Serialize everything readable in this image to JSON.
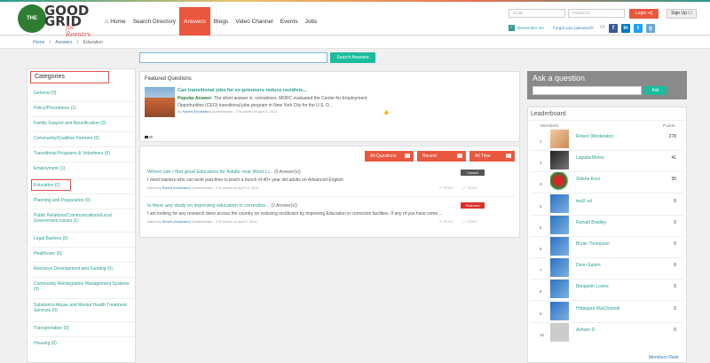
{
  "header": {
    "logo_badge": "THE",
    "logo_name_line1": "GOOD",
    "logo_name_line2": "GRID",
    "logo_sub": "for Reentry",
    "nav": [
      "Home",
      "Search Directory",
      "Answers",
      "Blogs",
      "Video Channel",
      "Events",
      "Jobs"
    ],
    "active_nav": "Answers",
    "email_placeholder": "Email",
    "password_placeholder": "Password",
    "login_label": "Login ➔]",
    "signup_label": "Sign Up ☐",
    "remember_label": "Remember me",
    "forgot_label": "Forgot your password?",
    "or_label": "Or",
    "social": [
      {
        "icon": "facebook-icon",
        "glyph": "f",
        "color": "#3b5998"
      },
      {
        "icon": "linkedin-icon",
        "glyph": "in",
        "color": "#0077b5"
      },
      {
        "icon": "twitter-icon",
        "glyph": "t",
        "color": "#1da1f2"
      },
      {
        "icon": "google-icon",
        "glyph": "g",
        "color": "#6aa7d8"
      }
    ]
  },
  "breadcrumb": [
    "Home",
    "/",
    "Answers",
    "/",
    "Education"
  ],
  "search": {
    "button": "Search Answers"
  },
  "categories": {
    "title": "Categories",
    "active": "Education (2)",
    "items": [
      "General (0)",
      "Policy/Procedures (1)",
      "Family Support and Reunification (0)",
      "Community/Coalition Partners (0)",
      "Transitional Programs & Volunteers (0)",
      "Employment (1)",
      "Education (2)",
      "Planning and Preparation (0)",
      "Public Relations/Communications/Local Government Issues (1)",
      "Legal Barriers (0)",
      "Healthcare (0)",
      "Resource Development and Funding (0)",
      "Community Reintegration Management Systems (0)",
      "Substance Abuse and Mental Health Treatment Services (0)",
      "Transportation (0)",
      "Housing (0)"
    ]
  },
  "featured": {
    "title": "Featured Questions",
    "question": "Can transitional jobs for ex-prisoners reduce recidivis...",
    "answer_label": "Popular Answer:",
    "answer_text": "The short answer is: sometimes. MDRC evaluated the Center for Employment Opportunities (CEO) transitional jobs program in New York City for the U.S. D...",
    "by_prefix": "By",
    "by_name": "Robert (Moderator)",
    "by_meta": "(Administrator - 278 points) on April 2, 2014",
    "like": "👍"
  },
  "filters": [
    "All Questions",
    "Recent",
    "All Time"
  ],
  "questions": [
    {
      "title": "Where can I find good Educators for Adults near West Li...",
      "count": "(0 Answer(s))",
      "body": "I need trainers who can work part-time to teach a bunch of 40+ year old adults on Advanced English",
      "by_prefix": "Asked by",
      "by_name": "Robert (Moderator)",
      "by_meta": "(Administrator - 278 points) on April 16, 2014",
      "tag": "Closed",
      "tag_color": "#555555",
      "share": "Share",
      "open": "Open"
    },
    {
      "title": "Is there any study on improving education in correction...",
      "count": "(2 Answer(s))",
      "body": "I am looking for any research done across the country on reducing recidivism by improving Education in correction facilities. If any of you have come ...",
      "by_prefix": "Asked by",
      "by_name": "Robert (Moderator)",
      "by_meta": "(Administrator - 278 points) on April 2, 2014",
      "tag": "Featured",
      "tag_color": "#d9302c",
      "share": "Share",
      "open": "Open"
    }
  ],
  "ask": {
    "title": "Ask a question",
    "button": "Ask"
  },
  "leaderboard": {
    "title": "Leaderboard",
    "col_members": "Members",
    "col_points": "Points",
    "rows": [
      {
        "rank": "1",
        "name": "Robert (Moderator)",
        "points": "278"
      },
      {
        "rank": "2",
        "name": "Laquita Morris",
        "points": "41"
      },
      {
        "rank": "3",
        "name": "Shikha Koul",
        "points": "30"
      },
      {
        "rank": "4",
        "name": "test2 ed",
        "points": "0"
      },
      {
        "rank": "5",
        "name": "Ronald Bradley",
        "points": "0"
      },
      {
        "rank": "6",
        "name": "Bryan Thompson",
        "points": "0"
      },
      {
        "rank": "7",
        "name": "Deon Ealom",
        "points": "0"
      },
      {
        "rank": "8",
        "name": "Benjamin Lovins",
        "points": "0"
      },
      {
        "rank": "9",
        "name": "Hildegard MacDonnell",
        "points": "0"
      },
      {
        "rank": "10",
        "name": "Ashwin D",
        "points": "0"
      }
    ],
    "members_rank": "Members Rank"
  }
}
